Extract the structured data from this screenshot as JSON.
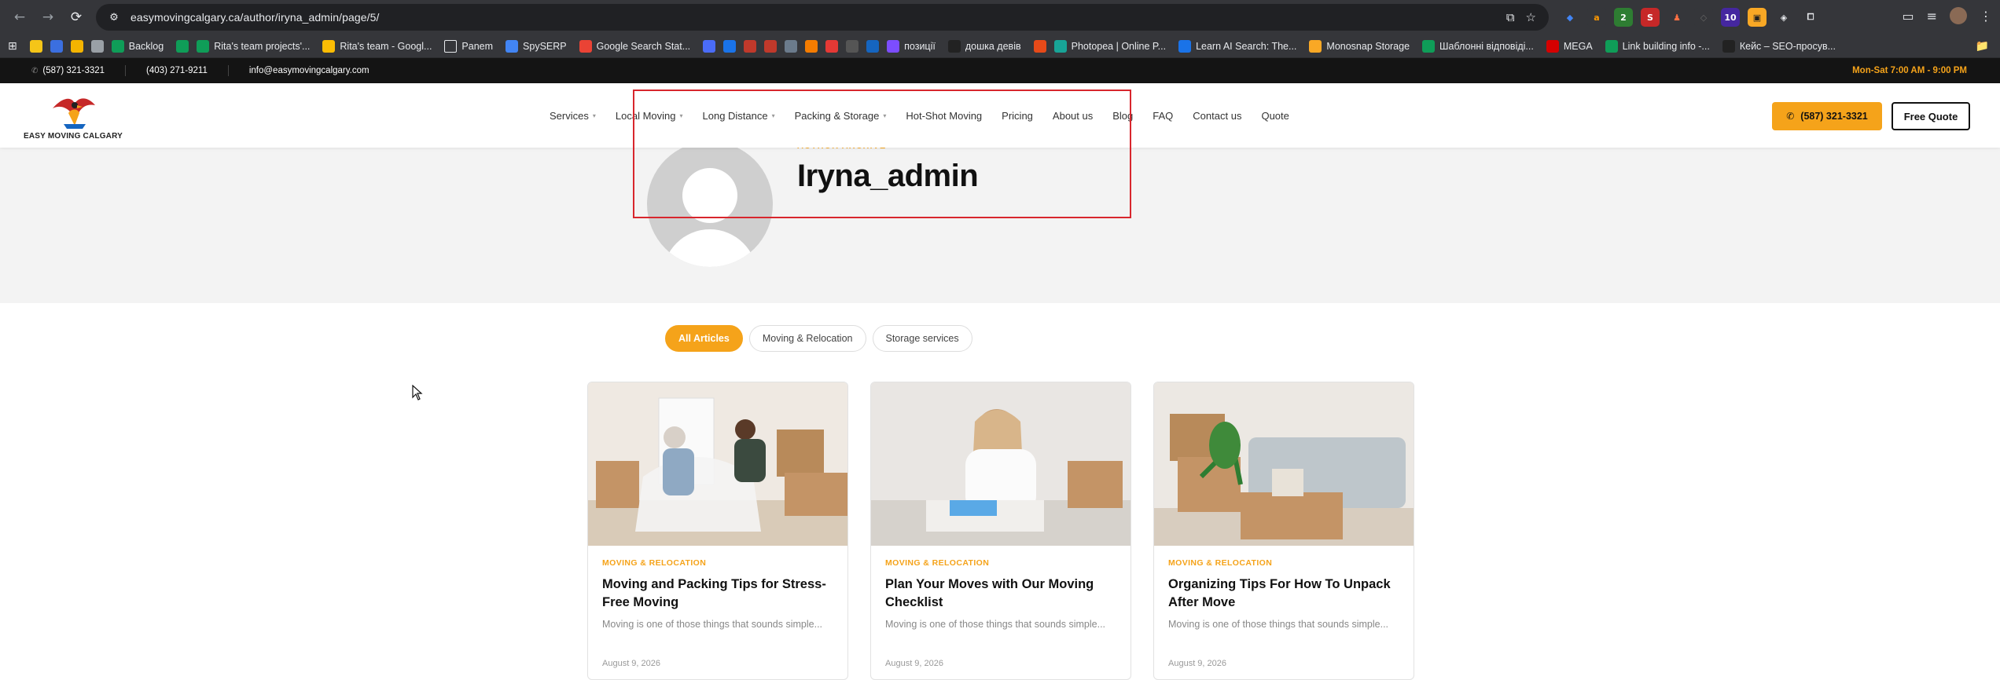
{
  "browser": {
    "url": "easymovingcalgary.ca/author/iryna_admin/page/5/",
    "bookmarks": [
      {
        "label": "",
        "color": "#f5c518"
      },
      {
        "label": "",
        "color": "#3b6fe0"
      },
      {
        "label": "",
        "color": "#f4b400"
      },
      {
        "label": "",
        "color": "#9aa0a6"
      },
      {
        "label": "Backlog",
        "color": "#0f9d58"
      },
      {
        "label": "",
        "color": "#0f9d58"
      },
      {
        "label": "Rita's team projects'...",
        "color": "#0f9d58"
      },
      {
        "label": "Rita's team - Googl...",
        "color": "#fbbc04"
      },
      {
        "label": "Panem",
        "color": "transparent"
      },
      {
        "label": "SpySERP",
        "color": "#4285f4"
      },
      {
        "label": "Google Search Stat...",
        "color": "#ea4335"
      },
      {
        "label": "",
        "color": "#4a6cf7"
      },
      {
        "label": "",
        "color": "#1a73e8"
      },
      {
        "label": "",
        "color": "#c0392b"
      },
      {
        "label": "",
        "color": "#c0392b"
      },
      {
        "label": "",
        "color": "#6b7b8c"
      },
      {
        "label": "",
        "color": "#f57c00"
      },
      {
        "label": "",
        "color": "#e53935"
      },
      {
        "label": "",
        "color": "#555"
      },
      {
        "label": "",
        "color": "#1565c0"
      },
      {
        "label": "позиції",
        "color": "#7c4dff"
      },
      {
        "label": "дошка девів",
        "color": "#222"
      },
      {
        "label": "",
        "color": "#e64a19"
      },
      {
        "label": "Photopea | Online P...",
        "color": "#18a497"
      },
      {
        "label": "Learn AI Search: The...",
        "color": "#1a73e8"
      },
      {
        "label": "Monosnap Storage",
        "color": "#f9a825"
      },
      {
        "label": "Шаблонні відповіді...",
        "color": "#0f9d58"
      },
      {
        "label": "MEGA",
        "color": "#d50000"
      },
      {
        "label": "Link building info -...",
        "color": "#0f9d58"
      },
      {
        "label": "Кейс – SEO-просув...",
        "color": "#222"
      }
    ]
  },
  "topbar": {
    "phone1": "(587) 321-3321",
    "phone2": "(403) 271-9211",
    "email": "info@easymovingcalgary.com",
    "hours": "Mon-Sat 7:00 AM - 9:00 PM"
  },
  "header": {
    "logo_text": "EASY MOVING CALGARY",
    "nav": [
      {
        "label": "Services",
        "dropdown": true
      },
      {
        "label": "Local Moving",
        "dropdown": true
      },
      {
        "label": "Long Distance",
        "dropdown": true
      },
      {
        "label": "Packing & Storage",
        "dropdown": true
      },
      {
        "label": "Hot-Shot Moving",
        "dropdown": false
      },
      {
        "label": "Pricing",
        "dropdown": false
      },
      {
        "label": "About us",
        "dropdown": false
      },
      {
        "label": "Blog",
        "dropdown": false
      },
      {
        "label": "FAQ",
        "dropdown": false
      },
      {
        "label": "Contact us",
        "dropdown": false
      },
      {
        "label": "Quote",
        "dropdown": false
      }
    ],
    "call_label": "(587) 321-3321",
    "quote_label": "Free Quote"
  },
  "hero": {
    "kicker": "AUTHOR ARCHIVE",
    "name": "Iryna_admin"
  },
  "filters": [
    "All Articles",
    "Moving & Relocation",
    "Storage services"
  ],
  "active_filter": "All Articles",
  "posts": [
    {
      "category": "MOVING & RELOCATION",
      "title": "Moving and Packing Tips for Stress-Free Moving",
      "excerpt": "Moving is one of those things that sounds simple...",
      "date": "August 9, 2026"
    },
    {
      "category": "MOVING & RELOCATION",
      "title": "Plan Your Moves with Our Moving Checklist",
      "excerpt": "Moving is one of those things that sounds simple...",
      "date": "August 9, 2026"
    },
    {
      "category": "MOVING & RELOCATION",
      "title": "Organizing Tips For How To Unpack After Move",
      "excerpt": "Moving is one of those things that sounds simple...",
      "date": "August 9, 2026"
    }
  ],
  "colors": {
    "accent": "#f5a31a",
    "annotation": "#d8262d"
  }
}
